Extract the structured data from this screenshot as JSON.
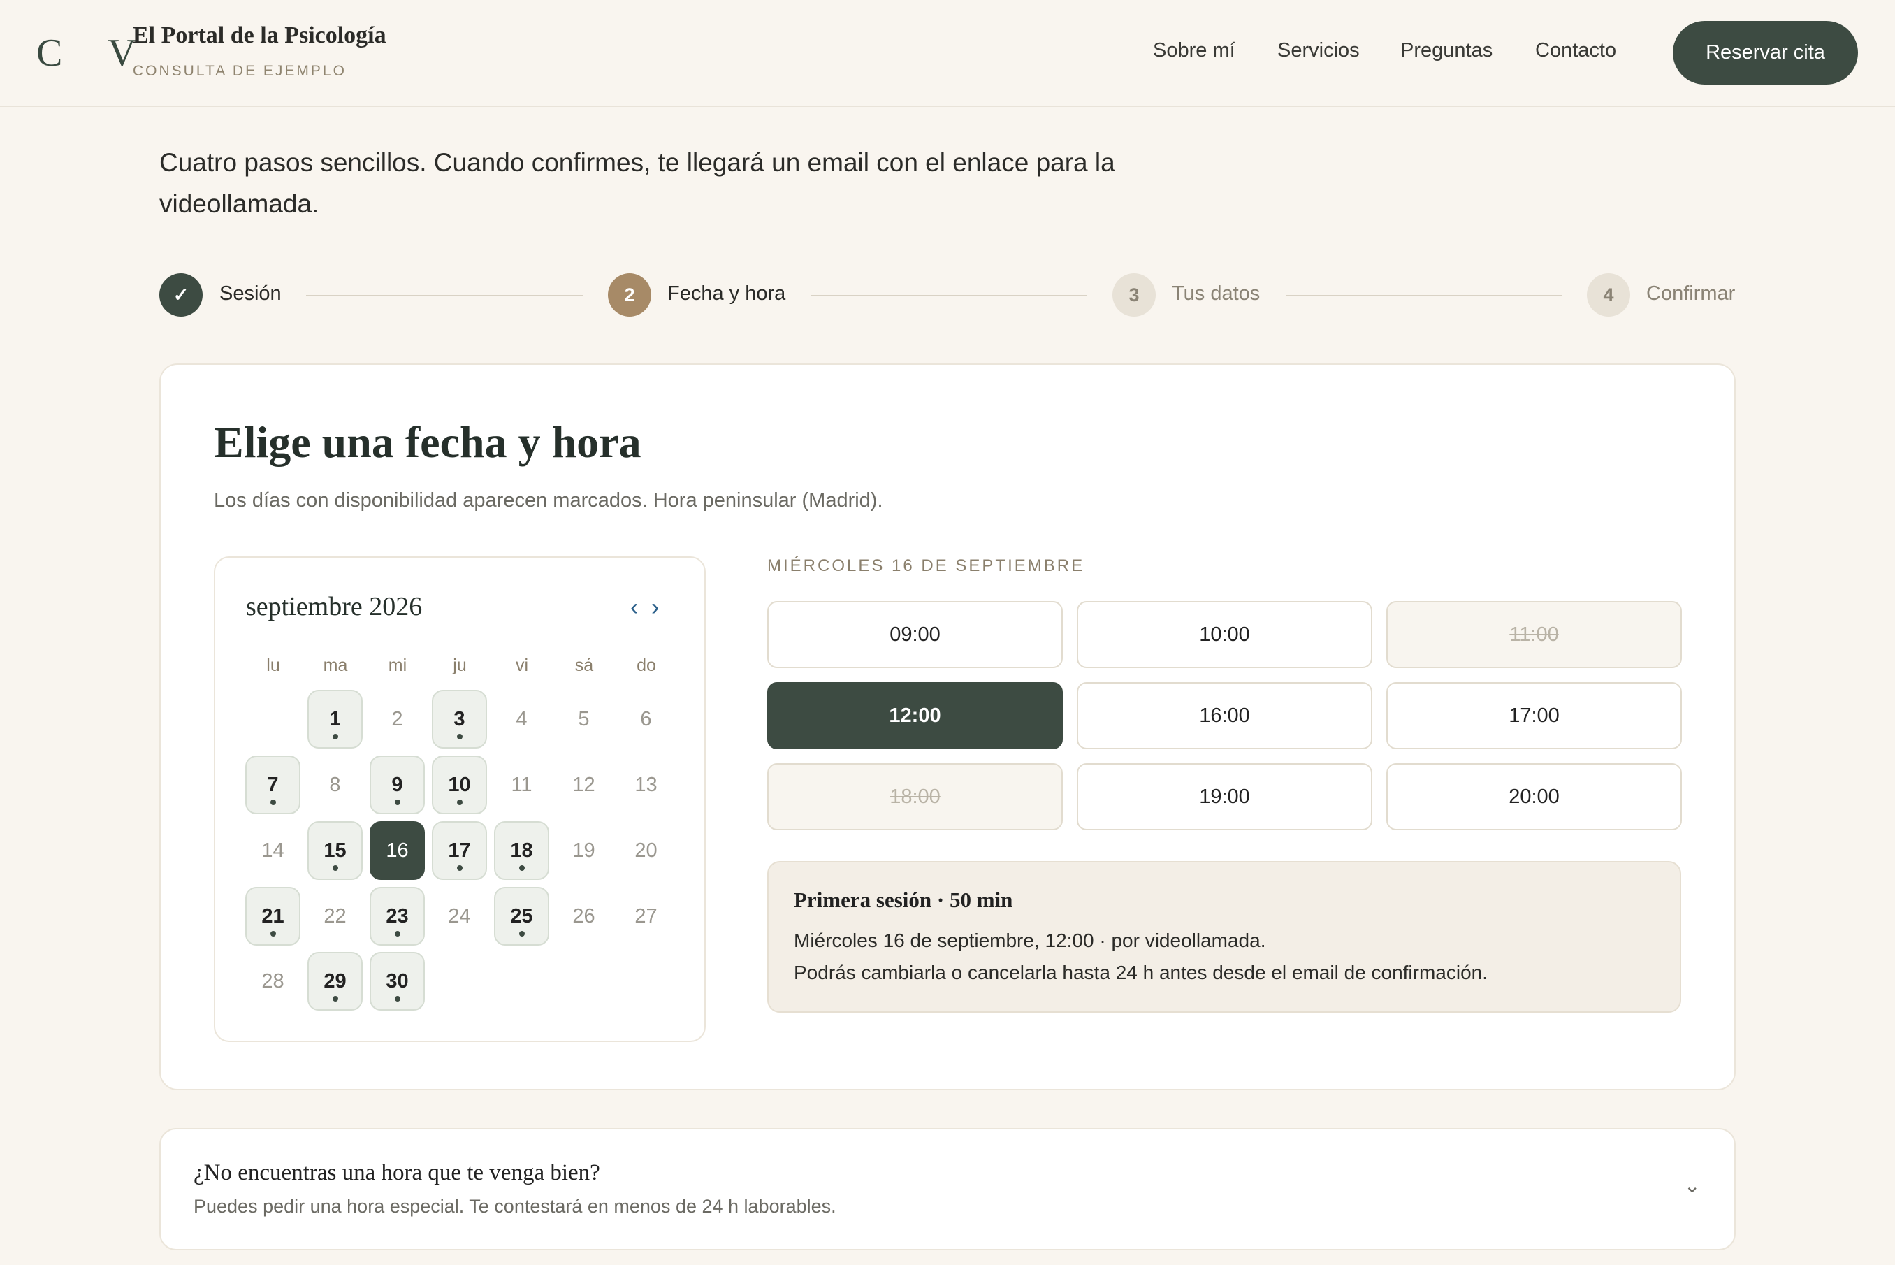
{
  "header": {
    "logo": "C V",
    "title": "El Portal de la Psicología",
    "subtitle": "CONSULTA DE EJEMPLO",
    "nav": [
      "Sobre mí",
      "Servicios",
      "Preguntas",
      "Contacto"
    ],
    "cta": "Reservar cita"
  },
  "intro": "Cuatro pasos sencillos. Cuando confirmes, te llegará un email con el enlace para la videollamada.",
  "steps": [
    {
      "marker": "✓",
      "label": "Sesión",
      "state": "done"
    },
    {
      "marker": "2",
      "label": "Fecha y hora",
      "state": "current"
    },
    {
      "marker": "3",
      "label": "Tus datos",
      "state": "pending"
    },
    {
      "marker": "4",
      "label": "Confirmar",
      "state": "pending"
    }
  ],
  "picker": {
    "title": "Elige una fecha y hora",
    "subtitle": "Los días con disponibilidad aparecen marcados. Hora peninsular (Madrid)."
  },
  "calendar": {
    "month": "septiembre 2026",
    "prev": "‹",
    "next": "›",
    "weekdays": [
      "lu",
      "ma",
      "mi",
      "ju",
      "vi",
      "sá",
      "do"
    ],
    "first_weekday_index": 1,
    "days_in_month": 30,
    "available": [
      1,
      3,
      7,
      9,
      10,
      15,
      17,
      18,
      21,
      23,
      25,
      29,
      30
    ],
    "selected": 16
  },
  "slots": {
    "heading": "MIÉRCOLES 16 DE SEPTIEMBRE",
    "items": [
      {
        "time": "09:00",
        "state": "free"
      },
      {
        "time": "10:00",
        "state": "free"
      },
      {
        "time": "11:00",
        "state": "taken"
      },
      {
        "time": "12:00",
        "state": "selected"
      },
      {
        "time": "16:00",
        "state": "free"
      },
      {
        "time": "17:00",
        "state": "free"
      },
      {
        "time": "18:00",
        "state": "taken"
      },
      {
        "time": "19:00",
        "state": "free"
      },
      {
        "time": "20:00",
        "state": "free"
      }
    ]
  },
  "summary": {
    "title": "Primera sesión · 50 min",
    "line1": "Miércoles 16 de septiembre, 12:00 · por videollamada.",
    "line2": "Podrás cambiarla o cancelarla hasta 24 h antes desde el email de confirmación."
  },
  "help": {
    "title": "¿No encuentras una hora que te venga bien?",
    "subtitle": "Puedes pedir una hora especial. Te contestará en menos de 24 h laborables.",
    "chevron": "⌄"
  },
  "colors": {
    "background": "#f9f5ef",
    "primary": "#3d4b42",
    "accent": "#a78a67",
    "pending": "#e8e2d7"
  }
}
